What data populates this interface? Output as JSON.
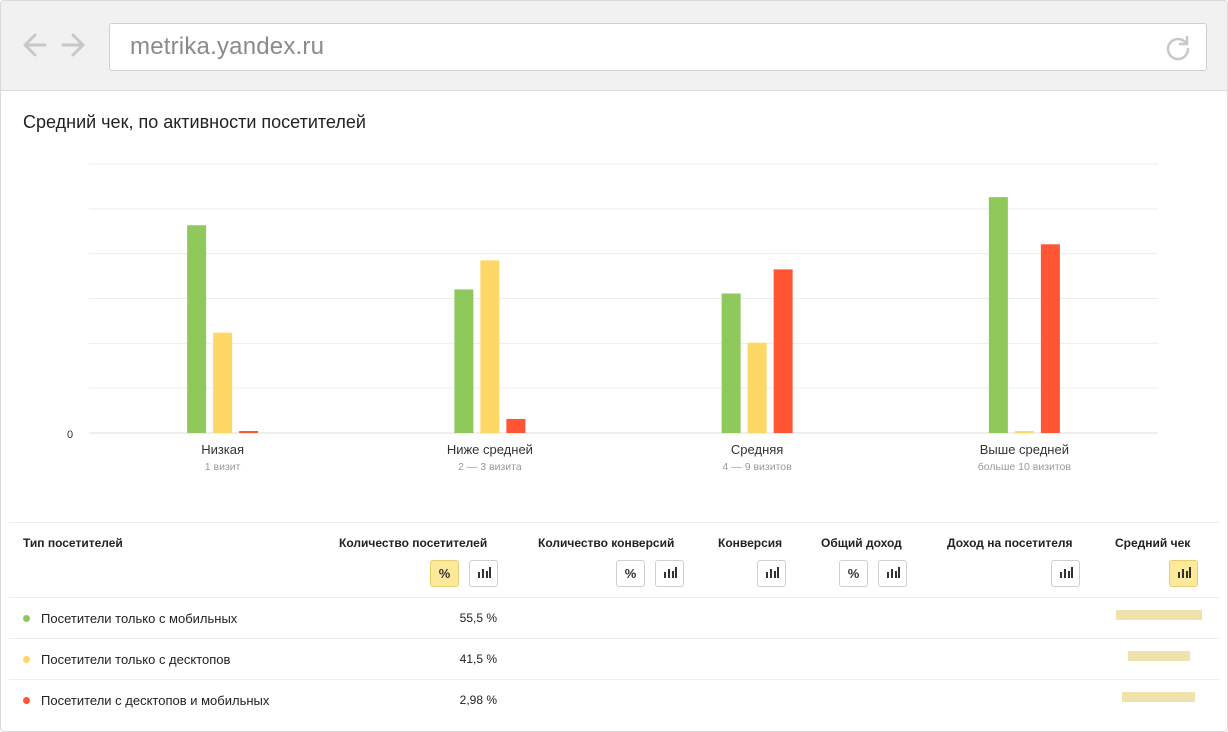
{
  "browser": {
    "url": "metrika.yandex.ru"
  },
  "report": {
    "title": "Средний чек, по активности посетителей"
  },
  "chart_data": {
    "type": "bar",
    "zero_label": "0",
    "categories": [
      "Низкая",
      "Ниже средней",
      "Средняя",
      "Выше средней"
    ],
    "category_sublabels": [
      "1 визит",
      "2 — 3 визита",
      "4 — 9 визитов",
      "больше 10 визитов"
    ],
    "series": [
      {
        "values": [
          207,
          143,
          139,
          235
        ],
        "color": "#8fc95c"
      },
      {
        "values": [
          100,
          172,
          90,
          2
        ],
        "color": "#fed866"
      },
      {
        "values": [
          2,
          14,
          163,
          188
        ],
        "color": "#ff5533"
      }
    ],
    "ylim": [
      0,
      268
    ],
    "grid": true
  },
  "table": {
    "columns": [
      {
        "label": "Тип посетителей"
      },
      {
        "label": "Количество посетителей"
      },
      {
        "label": "Количество конверсий"
      },
      {
        "label": "Конверсия"
      },
      {
        "label": "Общий доход"
      },
      {
        "label": "Доход на посетителя"
      },
      {
        "label": "Средний чек"
      }
    ],
    "icons": {
      "percent": "%"
    },
    "rows": [
      {
        "label": "Посетители только с мобильных",
        "visitors": "55,5 %",
        "color": "#8fc95c",
        "avg_check_share": 0.86
      },
      {
        "label": "Посетители только с десктопов",
        "visitors": "41,5 %",
        "color": "#fed866",
        "avg_check_share": 0.62
      },
      {
        "label": "Посетители с десктопов и мобильных",
        "visitors": "2,98 %",
        "color": "#ff5533",
        "avg_check_share": 0.73
      }
    ]
  }
}
